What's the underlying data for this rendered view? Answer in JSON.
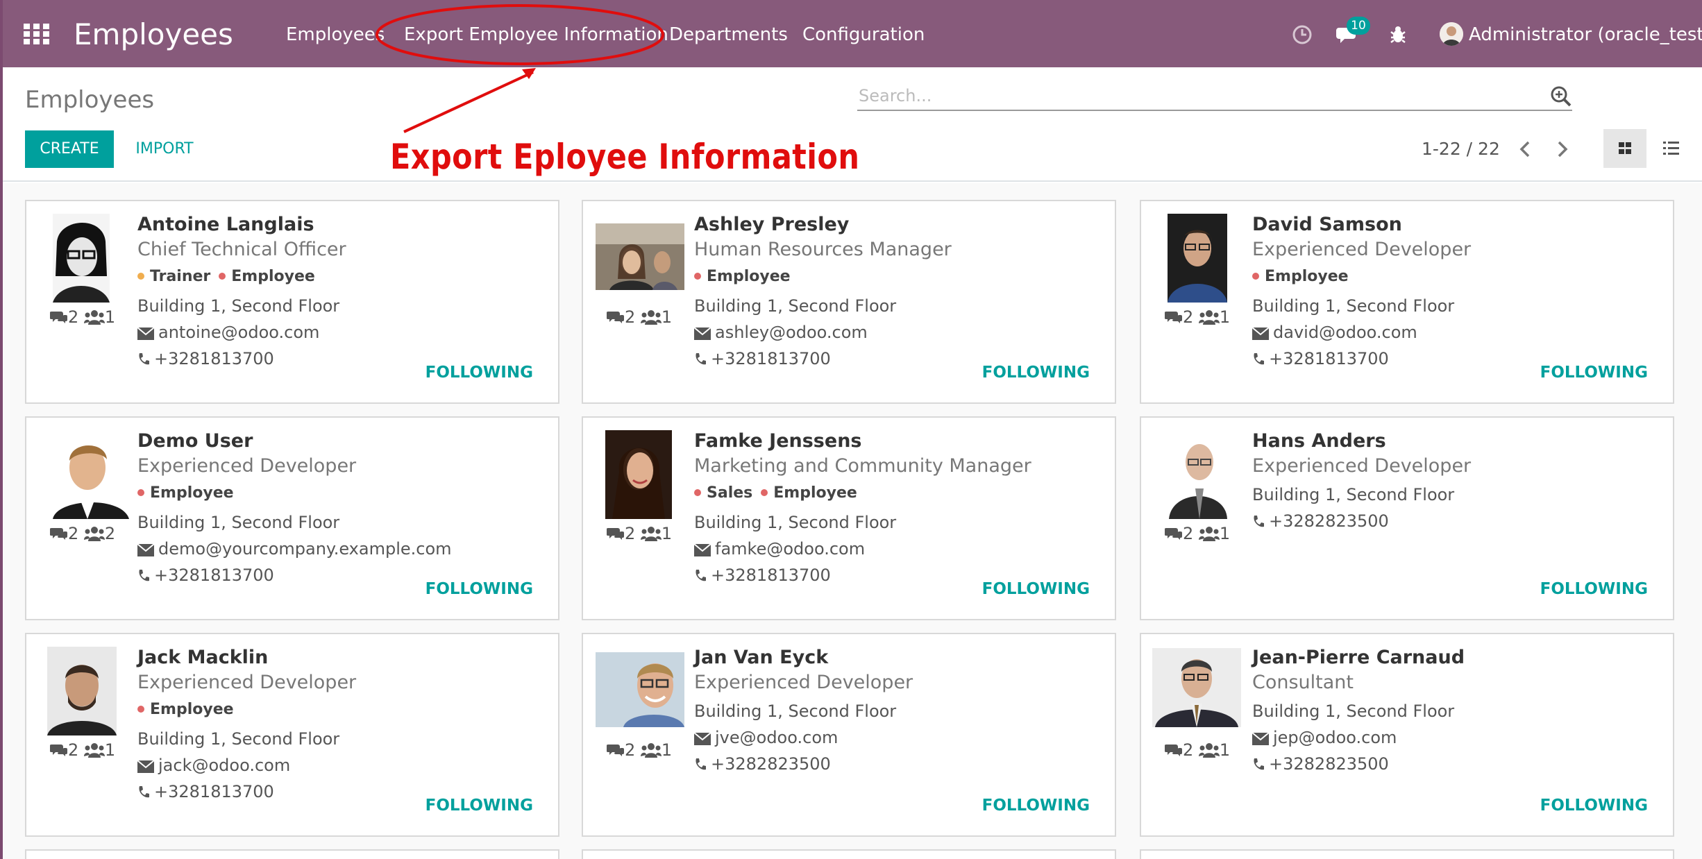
{
  "navbar": {
    "app_title": "Employees",
    "menu": [
      "Employees",
      "Export Employee Information",
      "Departments",
      "Configuration"
    ],
    "message_badge": "10",
    "user": "Administrator (oracle_test)",
    "bg_color": "#875a7b"
  },
  "control_panel": {
    "breadcrumb": "Employees",
    "search_placeholder": "Search...",
    "create_label": "CREATE",
    "import_label": "IMPORT",
    "pager": "1-22 / 22",
    "accent_color": "#00a09d"
  },
  "annotation": {
    "text": "Export Eployee Information",
    "color": "#e00d0d"
  },
  "employees": [
    {
      "name": "Antoine Langlais",
      "job": "Chief Technical Officer",
      "tags": [
        "Trainer",
        "Employee"
      ],
      "location": "Building 1, Second Floor",
      "email": "antoine@odoo.com",
      "phone": "+3281813700",
      "messages": "2",
      "followers": "1",
      "follow": "FOLLOWING"
    },
    {
      "name": "Ashley Presley",
      "job": "Human Resources Manager",
      "tags": [
        "Employee"
      ],
      "location": "Building 1, Second Floor",
      "email": "ashley@odoo.com",
      "phone": "+3281813700",
      "messages": "2",
      "followers": "1",
      "follow": "FOLLOWING"
    },
    {
      "name": "David Samson",
      "job": "Experienced Developer",
      "tags": [
        "Employee"
      ],
      "location": "Building 1, Second Floor",
      "email": "david@odoo.com",
      "phone": "+3281813700",
      "messages": "2",
      "followers": "1",
      "follow": "FOLLOWING"
    },
    {
      "name": "Demo User",
      "job": "Experienced Developer",
      "tags": [
        "Employee"
      ],
      "location": "Building 1, Second Floor",
      "email": "demo@yourcompany.example.com",
      "phone": "+3281813700",
      "messages": "2",
      "followers": "2",
      "follow": "FOLLOWING"
    },
    {
      "name": "Famke Jenssens",
      "job": "Marketing and Community Manager",
      "tags": [
        "Sales",
        "Employee"
      ],
      "location": "Building 1, Second Floor",
      "email": "famke@odoo.com",
      "phone": "+3281813700",
      "messages": "2",
      "followers": "1",
      "follow": "FOLLOWING"
    },
    {
      "name": "Hans Anders",
      "job": "Experienced Developer",
      "tags": [],
      "location": "Building 1, Second Floor",
      "email": "",
      "phone": "+3282823500",
      "messages": "2",
      "followers": "1",
      "follow": "FOLLOWING"
    },
    {
      "name": "Jack Macklin",
      "job": "Experienced Developer",
      "tags": [
        "Employee"
      ],
      "location": "Building 1, Second Floor",
      "email": "jack@odoo.com",
      "phone": "+3281813700",
      "messages": "2",
      "followers": "1",
      "follow": "FOLLOWING"
    },
    {
      "name": "Jan Van Eyck",
      "job": "Experienced Developer",
      "tags": [],
      "location": "Building 1, Second Floor",
      "email": "jve@odoo.com",
      "phone": "+3282823500",
      "messages": "2",
      "followers": "1",
      "follow": "FOLLOWING"
    },
    {
      "name": "Jean-Pierre Carnaud",
      "job": "Consultant",
      "tags": [],
      "location": "Building 1, Second Floor",
      "email": "jep@odoo.com",
      "phone": "+3282823500",
      "messages": "2",
      "followers": "1",
      "follow": "FOLLOWING"
    }
  ]
}
